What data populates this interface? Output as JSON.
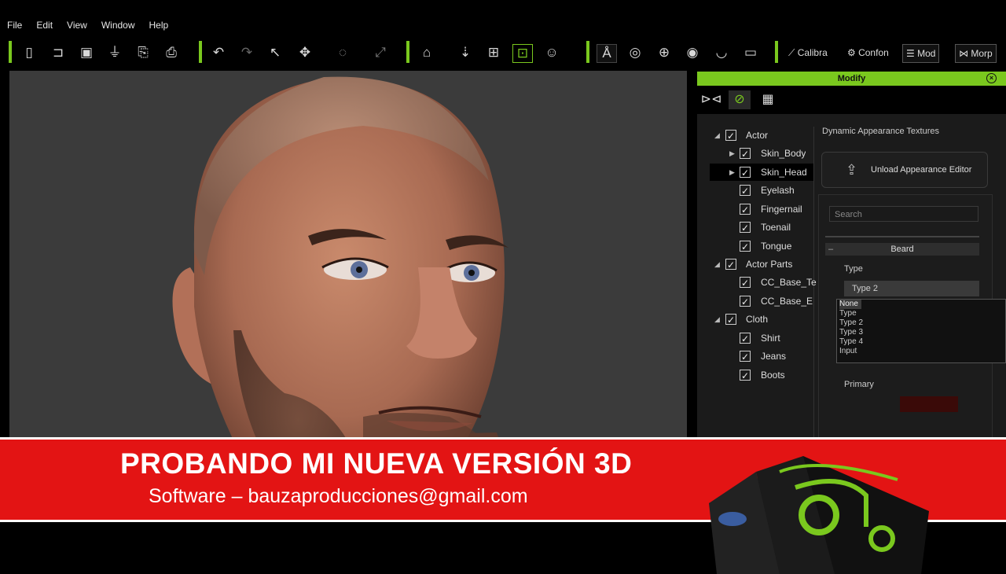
{
  "menu": [
    "File",
    "Edit",
    "View",
    "Window",
    "Help"
  ],
  "toolbar": {
    "labels": {
      "calibrate": "Calibra",
      "conform": "Confon",
      "modify": "Mod",
      "morph": "Morp"
    },
    "accent_color": "#7ac81e",
    "icons": [
      "new-file-icon",
      "open-folder-icon",
      "save-icon",
      "import-icon",
      "export-icon",
      "export-settings-icon",
      "undo-icon",
      "redo-icon",
      "select-arrow-icon",
      "move-icon",
      "rotate-icon",
      "scale-icon",
      "home-icon",
      "download-icon",
      "fit-icon",
      "pick-icon",
      "face-icon",
      "body-icon",
      "head-icon",
      "globe-icon",
      "eye-icon",
      "lips-icon",
      "teeth-icon",
      "calibrate-icon",
      "conform-icon",
      "sliders-icon",
      "morph-icon"
    ]
  },
  "panel": {
    "title": "Modify",
    "tabs": [
      "pose-tab",
      "material-tab",
      "texture-tab"
    ],
    "tree": [
      {
        "label": "Actor",
        "level": 0,
        "expanded": true
      },
      {
        "label": "Skin_Body",
        "level": 1,
        "collapsed": true
      },
      {
        "label": "Skin_Head",
        "level": 1,
        "collapsed": true,
        "selected": true
      },
      {
        "label": "Eyelash",
        "level": 1
      },
      {
        "label": "Fingernail",
        "level": 1
      },
      {
        "label": "Toenail",
        "level": 1
      },
      {
        "label": "Tongue",
        "level": 1
      },
      {
        "label": "Actor Parts",
        "level": 0,
        "expanded": true
      },
      {
        "label": "CC_Base_Te",
        "level": 1
      },
      {
        "label": "CC_Base_E",
        "level": 1
      },
      {
        "label": "Cloth",
        "level": 0,
        "expanded": true
      },
      {
        "label": "Shirt",
        "level": 1
      },
      {
        "label": "Jeans",
        "level": 1
      },
      {
        "label": "Boots",
        "level": 1
      }
    ],
    "dynamic_title": "Dynamic Appearance Textures",
    "unload_button": "Unload Appearance Editor",
    "search_placeholder": "Search",
    "section": "Beard",
    "type_label": "Type",
    "type_value": "Type 2",
    "type_options": [
      "None",
      "Type",
      "Type 2",
      "Type 3",
      "Type 4",
      "Input"
    ],
    "primary_label": "Primary",
    "primary_color": "#3a0a08"
  },
  "banner": {
    "title": "PROBANDO MI NUEVA VERSIÓN 3D",
    "subtitle": "Software – bauzaproducciones@gmail.com",
    "color": "#e31414"
  }
}
